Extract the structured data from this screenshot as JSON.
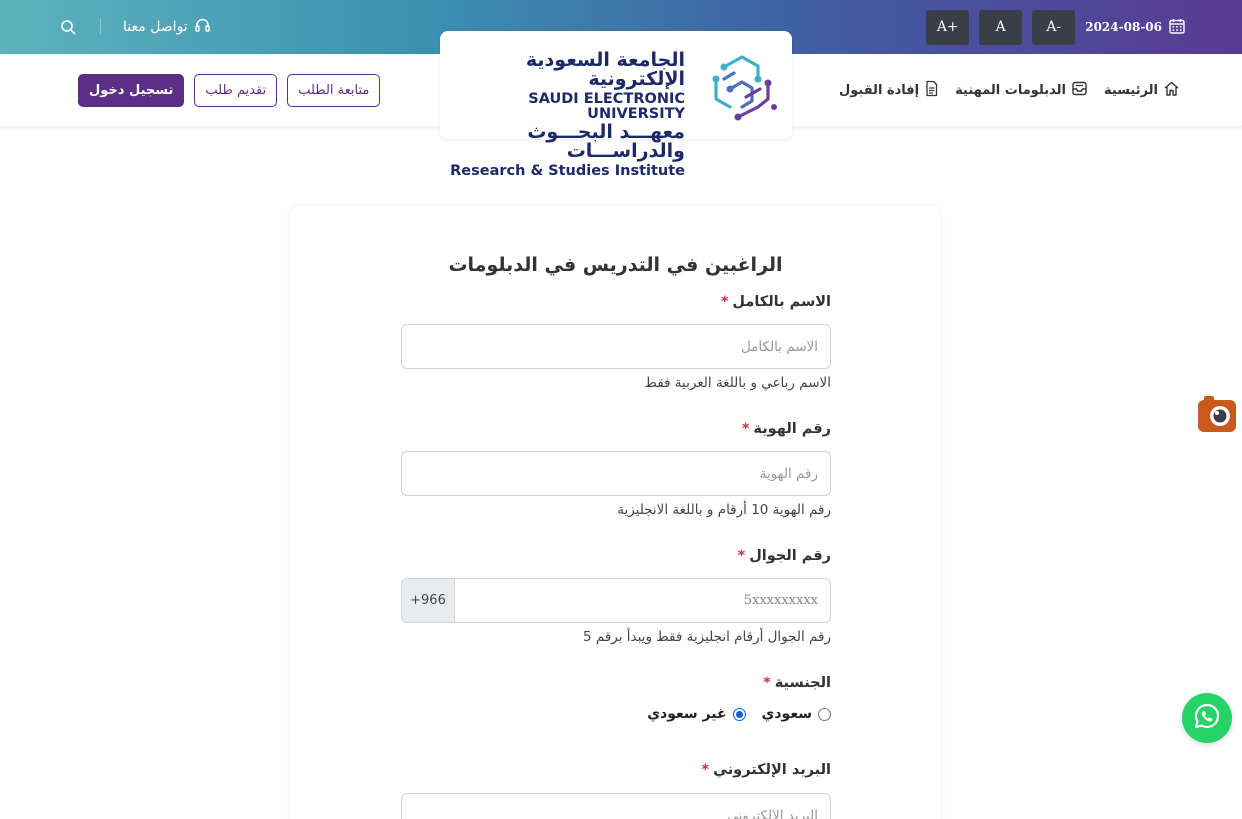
{
  "topbar": {
    "contact_label": "تواصل معنا",
    "date": "2024-08-06",
    "font_increase": "A+",
    "font_reset": "A",
    "font_decrease": "A-"
  },
  "nav": {
    "home": "الرئيسية",
    "diplomas": "الدبلومات المهنية",
    "acceptance": "إفادة القبول",
    "track_request": "متابعة الطلب",
    "submit_request": "تقديم طلب",
    "login": "تسجيل دخول"
  },
  "logo": {
    "ar_line1": "الجامعة السعودية الإلكترونية",
    "en_line1": "SAUDI ELECTRONIC UNIVERSITY",
    "ar_line2": "معهـــد البحـــوث والدراســـات",
    "en_line2": "Research & Studies Institute"
  },
  "form": {
    "title": "الراغبين في التدريس في الدبلومات",
    "required_mark": "*",
    "full_name": {
      "label": "الاسم بالكامل",
      "placeholder": "الاسم بالكامل",
      "hint": "الاسم رباعي و باللغة العربية فقط"
    },
    "id_number": {
      "label": "رقم الهوية",
      "placeholder": "رقم الهوية",
      "hint": "رقم الهوية 10 أرقام و باللغة الانجليزية"
    },
    "mobile": {
      "label": "رقم الجوال",
      "placeholder": "5xxxxxxxxx",
      "prefix": "+966",
      "hint": "رقم الجوال أرقام انجليزية فقط ويبدأ برقم 5"
    },
    "nationality": {
      "label": "الجنسية",
      "option_saudi": "سعودي",
      "option_non_saudi": "غير سعودي",
      "selected": "غير سعودي"
    },
    "email": {
      "label": "البريد الإلكتروني",
      "placeholder": "البريد الإلكتروني"
    }
  },
  "colors": {
    "primary": "#5a2f85",
    "required": "#d0303a",
    "whatsapp": "#25d366"
  }
}
